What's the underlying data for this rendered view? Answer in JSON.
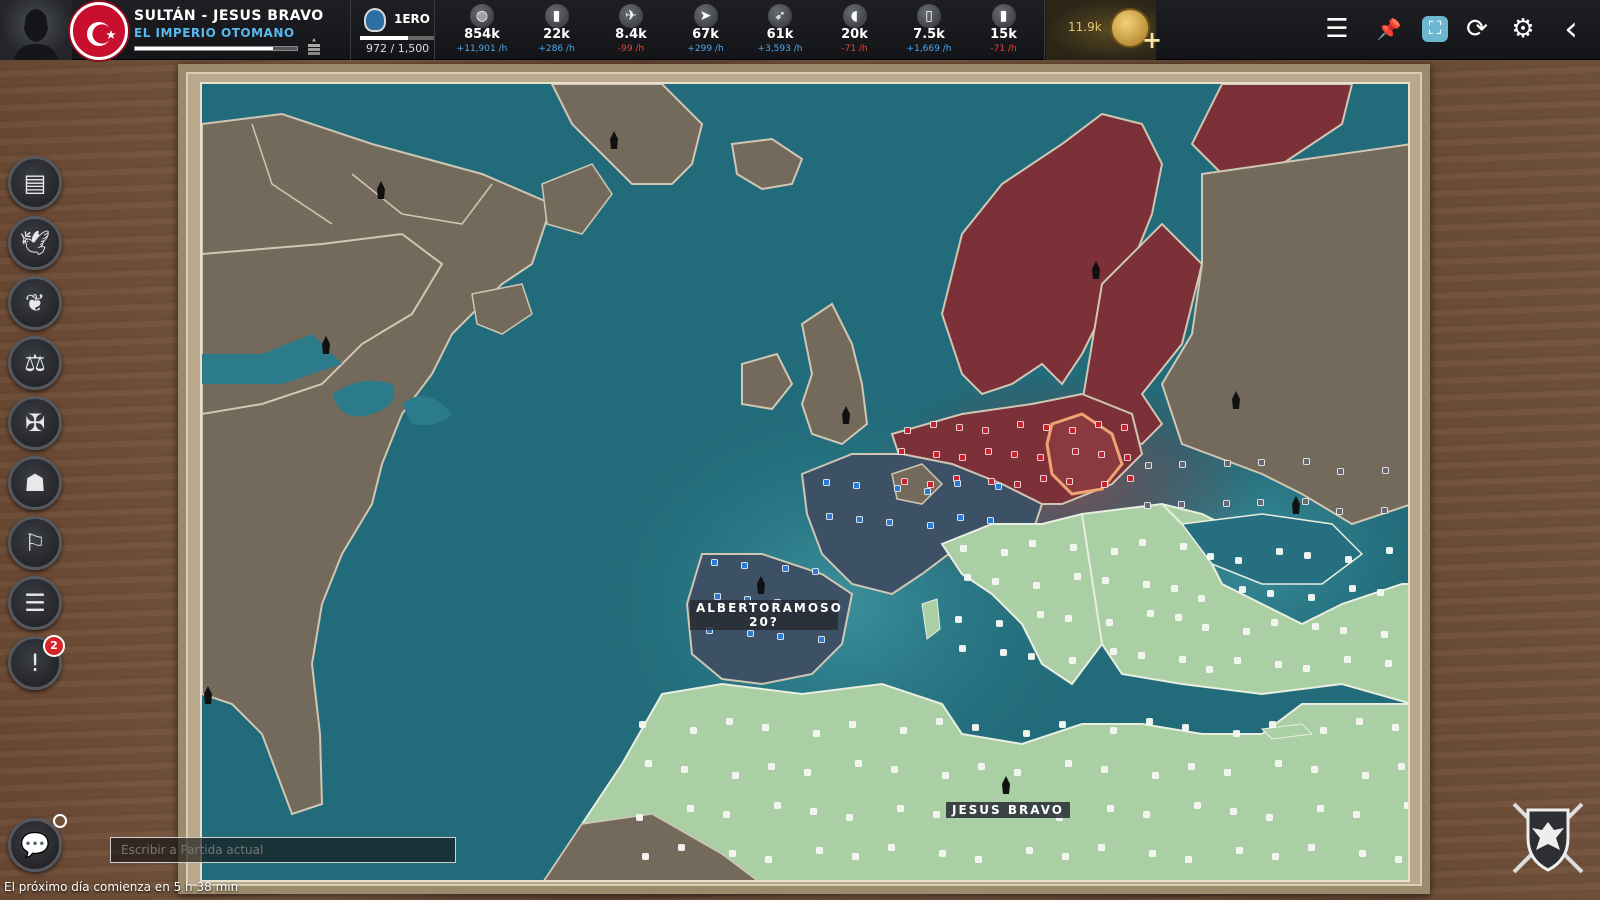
{
  "player": {
    "title_line": "SULTÁN - JESUS BRAVO",
    "nation": "EL IMPERIO OTOMANO",
    "progress": 0.85
  },
  "rank": {
    "label": "1ERO",
    "count": "972 / 1,500",
    "progress": 0.648
  },
  "resources": [
    {
      "icon": "silver-coins-icon",
      "glyph": "◍",
      "amount": "854k",
      "rate": "+11,901 /h",
      "sign": "pos"
    },
    {
      "icon": "bullet-icon",
      "glyph": "▮",
      "amount": "22k",
      "rate": "+286 /h",
      "sign": "pos"
    },
    {
      "icon": "airplane-icon",
      "glyph": "✈",
      "amount": "8.4k",
      "rate": "-99 /h",
      "sign": "neg"
    },
    {
      "icon": "jet-icon",
      "glyph": "➤",
      "amount": "67k",
      "rate": "+299 /h",
      "sign": "pos"
    },
    {
      "icon": "rocket-icon",
      "glyph": "➶",
      "amount": "61k",
      "rate": "+3,593 /h",
      "sign": "pos"
    },
    {
      "icon": "bread-icon",
      "glyph": "◖",
      "amount": "20k",
      "rate": "-71 /h",
      "sign": "neg"
    },
    {
      "icon": "oil-barrel-icon",
      "glyph": "▯",
      "amount": "7.5k",
      "rate": "+1,669 /h",
      "sign": "pos"
    },
    {
      "icon": "fuel-can-icon",
      "glyph": "▮",
      "amount": "15k",
      "rate": "-71 /h",
      "sign": "neg"
    }
  ],
  "gold": {
    "amount": "11.9k",
    "plus": "+"
  },
  "controls": {
    "menu": "☰",
    "pin": "📌",
    "expand": "⛶",
    "refresh": "⟳",
    "settings": "⚙",
    "back": "‹"
  },
  "sidebar": [
    {
      "name": "newspaper-button",
      "icon": "newspaper-icon",
      "glyph": "▤"
    },
    {
      "name": "diplomacy-button",
      "icon": "dove-icon",
      "glyph": "🕊"
    },
    {
      "name": "economy-button",
      "icon": "wheat-icon",
      "glyph": "❦"
    },
    {
      "name": "justice-button",
      "icon": "scales-icon",
      "glyph": "⚖"
    },
    {
      "name": "military-button",
      "icon": "iron-cross-icon",
      "glyph": "✠"
    },
    {
      "name": "intelligence-button",
      "icon": "spy-icon",
      "glyph": "☗"
    },
    {
      "name": "territory-button",
      "icon": "map-pin-flag-icon",
      "glyph": "⚐"
    },
    {
      "name": "army-list-button",
      "icon": "helmet-list-icon",
      "glyph": "☰"
    },
    {
      "name": "alerts-button",
      "icon": "exclamation-icon",
      "glyph": "!",
      "badge": "2"
    }
  ],
  "map": {
    "labels": [
      {
        "name": "player-label-alberto",
        "text": "ALBERTORAMOSO\n20?"
      },
      {
        "name": "player-label-jesus",
        "text": "JESUS BRAVO"
      }
    ]
  },
  "chat": {
    "placeholder": "Escribir a Partida actual"
  },
  "footer": {
    "next_day": "El próximo día comienza en 5 h 38 min"
  }
}
